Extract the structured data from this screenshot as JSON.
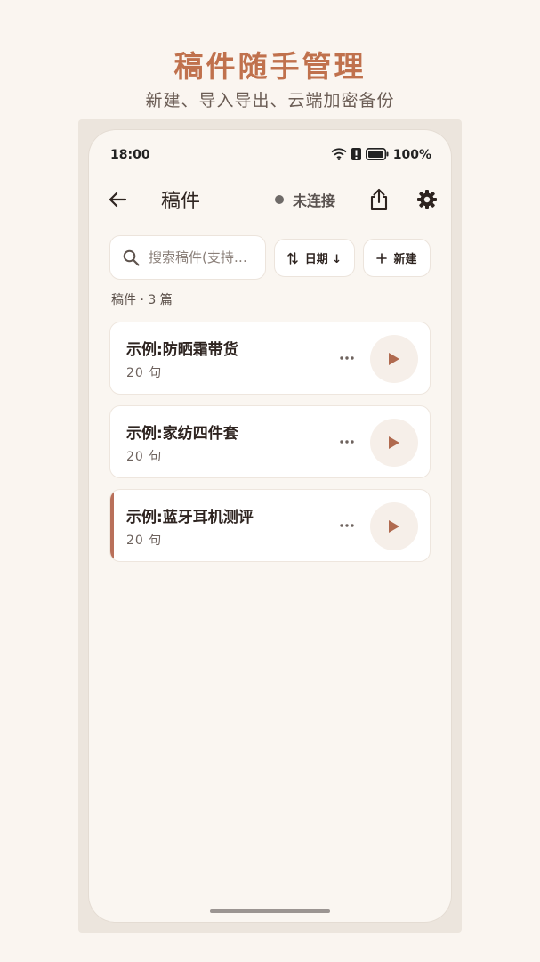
{
  "promo": {
    "title": "稿件随手管理",
    "subtitle": "新建、导入导出、云端加密备份"
  },
  "status_bar": {
    "time": "18:00",
    "battery": "100%"
  },
  "app_bar": {
    "title": "稿件",
    "connection_status": "未连接",
    "icons": [
      "back-arrow-icon",
      "share-icon",
      "settings-gear-icon"
    ]
  },
  "toolbar": {
    "search_placeholder": "搜索稿件(支持…",
    "sort_label": "日期 ↓",
    "new_label": "新建"
  },
  "list": {
    "count_label": "稿件 · 3 篇",
    "items": [
      {
        "title": "示例:防晒霜带货",
        "sub": "20 句",
        "active": false
      },
      {
        "title": "示例:家纺四件套",
        "sub": "20 句",
        "active": false
      },
      {
        "title": "示例:蓝牙耳机测评",
        "sub": "20 句",
        "active": true
      }
    ]
  },
  "colors": {
    "accent": "#c0714d",
    "background": "#faf5f0",
    "play_icon": "#b06a4f"
  }
}
